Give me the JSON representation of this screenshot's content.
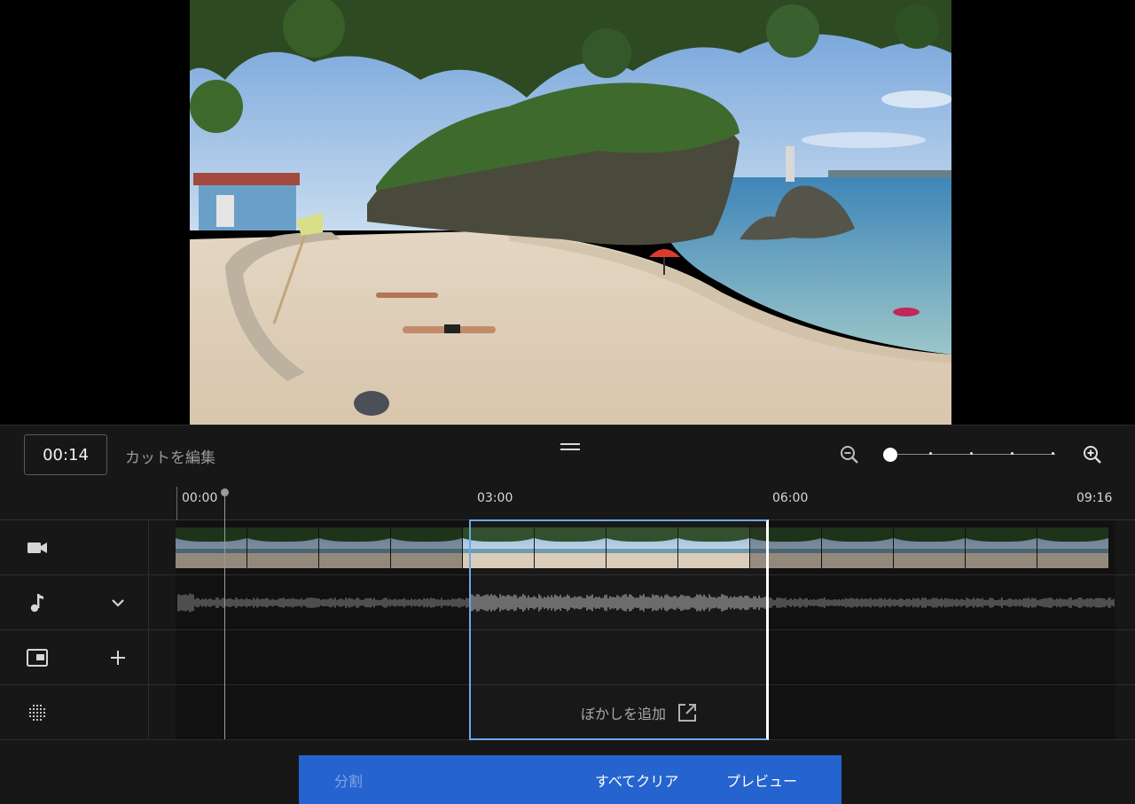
{
  "player": {
    "current_time": "00:14"
  },
  "editor": {
    "title": "カットを編集",
    "zoom_level": 0.0
  },
  "timeline": {
    "ticks": [
      "00:00",
      "03:00",
      "06:00",
      "09:16"
    ],
    "selection_start": "03:00",
    "selection_end": "06:00"
  },
  "tracks": [
    {
      "name": "video",
      "icon": "video-camera-icon"
    },
    {
      "name": "audio",
      "icon": "music-note-icon",
      "action": "chevron-down-icon"
    },
    {
      "name": "end-screen",
      "icon": "picture-in-picture-icon",
      "action": "plus-icon"
    },
    {
      "name": "blur",
      "icon": "blur-dots-icon"
    }
  ],
  "blur": {
    "link_label": "ぼかしを追加"
  },
  "actions": {
    "split_label": "分割",
    "clear_all_label": "すべてクリア",
    "preview_label": "プレビュー"
  },
  "colors": {
    "accent": "#2563cf",
    "selection_border": "#6aa9e8",
    "panel_bg": "#171717"
  }
}
